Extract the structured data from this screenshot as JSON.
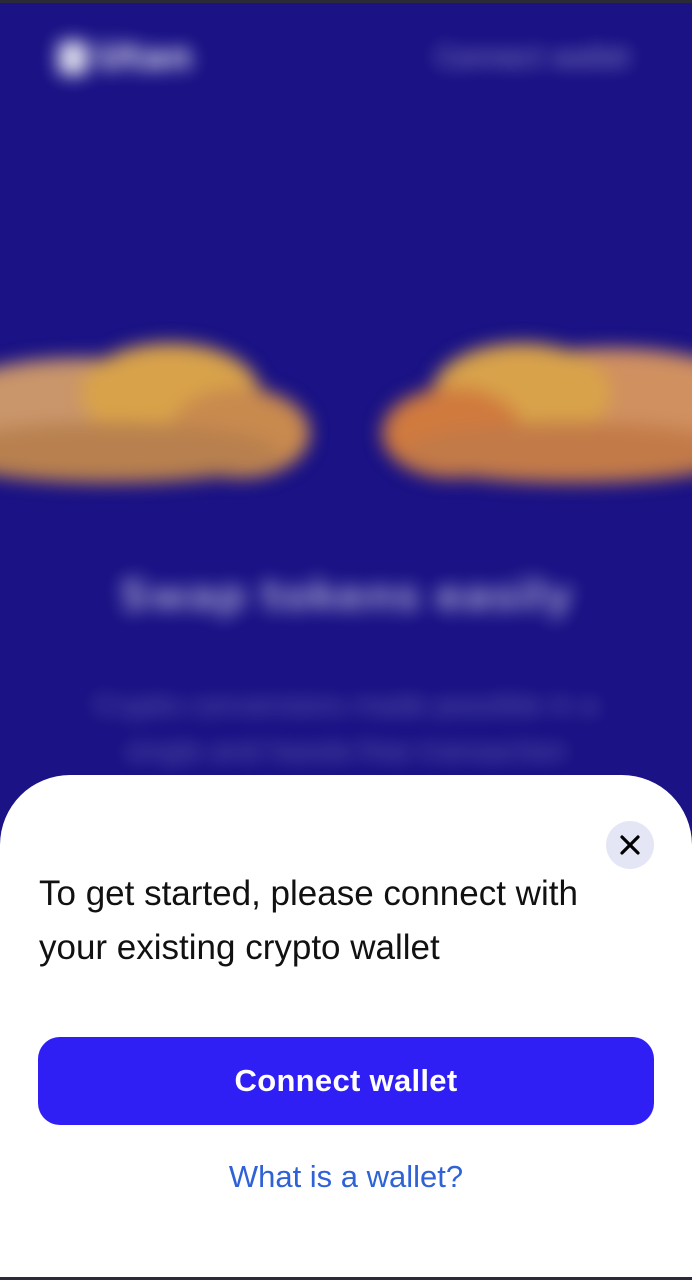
{
  "background": {
    "logo_text": "Utan",
    "header_connect_label": "Connect wallet",
    "hero_title": "Swap tokens easily",
    "hero_subtitle": "Crypto conversions made possible in a single and hassle-free transaction"
  },
  "sheet": {
    "message": "To get started, please connect with your existing crypto wallet",
    "connect_button_label": "Connect wallet",
    "help_link_label": "What is a wallet?",
    "close_icon": "close-icon"
  },
  "colors": {
    "background": "#1a1285",
    "primary_button": "#2f1ff5",
    "link": "#2f62d6",
    "close_button_bg": "#e4e6f6"
  }
}
